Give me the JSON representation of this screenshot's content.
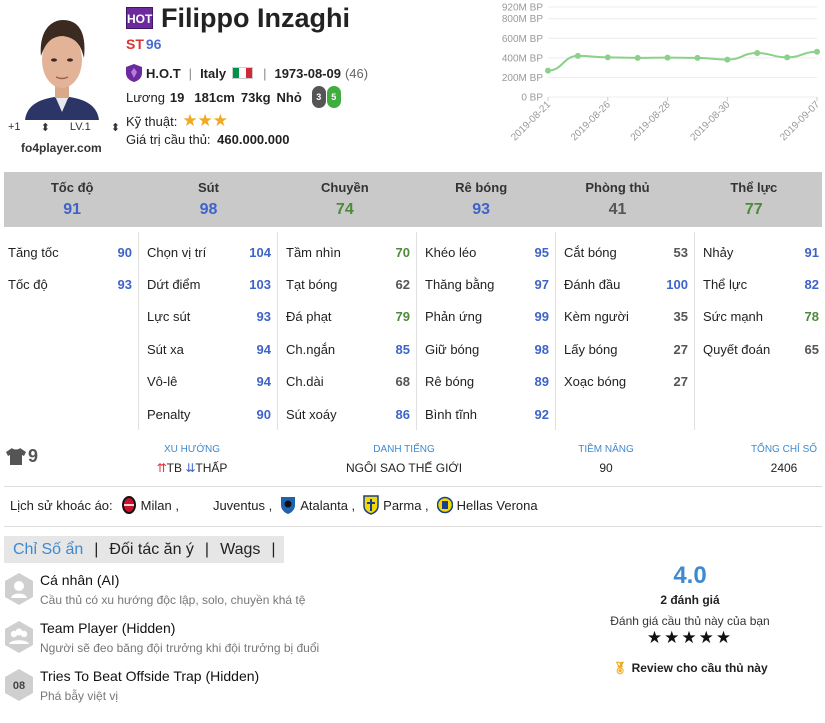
{
  "header": {
    "badge": "HOT",
    "name": "Filippo Inzaghi",
    "position": "ST",
    "overall": "96",
    "season": "H.O.T",
    "nation": "Italy",
    "birthdate": "1973-08-09",
    "age": "(46)",
    "salary_label": "Lương",
    "salary": "19",
    "height": "181cm",
    "weight": "73kg",
    "body": "Nhỏ",
    "weak_foot": "3",
    "strong_foot": "5",
    "skill_label": "Kỹ thuật:",
    "skill_stars": 3,
    "skill_stars_text": "★★★",
    "value_label": "Giá trị cầu thủ:",
    "value": "460.000.000",
    "upgrade": "+1",
    "level": "LV.1",
    "site": "fo4player.com",
    "colors": {
      "hot": "#6c2a9e",
      "position": "#dd3333",
      "overall": "#4c6ccf"
    }
  },
  "price_chart": {
    "type": "line",
    "y_ticks": [
      "920M BP",
      "800M BP",
      "600M BP",
      "400M BP",
      "200M BP",
      "0 BP"
    ],
    "y_tick_values": [
      920,
      800,
      600,
      400,
      200,
      0
    ],
    "x_ticks": [
      "2019-08-21",
      "2019-08-26",
      "2019-08-28",
      "2019-08-30",
      "2019-09-07"
    ],
    "x_tick_index": [
      0,
      2,
      4,
      6,
      9
    ],
    "values": [
      270,
      420,
      405,
      400,
      402,
      400,
      382,
      450,
      405,
      462
    ],
    "ylim": [
      0,
      920
    ],
    "color": "#8bd08b"
  },
  "stats": {
    "headers": [
      {
        "label": "Tốc độ",
        "value": "91",
        "color": "blue"
      },
      {
        "label": "Sút",
        "value": "98",
        "color": "blue"
      },
      {
        "label": "Chuyền",
        "value": "74",
        "color": "green"
      },
      {
        "label": "Rê bóng",
        "value": "93",
        "color": "blue"
      },
      {
        "label": "Phòng thủ",
        "value": "41",
        "color": "grey"
      },
      {
        "label": "Thể lực",
        "value": "77",
        "color": "green"
      }
    ],
    "columns": [
      [
        {
          "label": "Tăng tốc",
          "value": "90",
          "color": "blue"
        },
        {
          "label": "Tốc độ",
          "value": "93",
          "color": "blue"
        }
      ],
      [
        {
          "label": "Chọn vị trí",
          "value": "104",
          "color": "blue"
        },
        {
          "label": "Dứt điểm",
          "value": "103",
          "color": "blue"
        },
        {
          "label": "Lực sút",
          "value": "93",
          "color": "blue"
        },
        {
          "label": "Sút xa",
          "value": "94",
          "color": "blue"
        },
        {
          "label": "Vô-lê",
          "value": "94",
          "color": "blue"
        },
        {
          "label": "Penalty",
          "value": "90",
          "color": "blue"
        }
      ],
      [
        {
          "label": "Tầm nhìn",
          "value": "70",
          "color": "green"
        },
        {
          "label": "Tạt bóng",
          "value": "62",
          "color": "grey"
        },
        {
          "label": "Đá phạt",
          "value": "79",
          "color": "green"
        },
        {
          "label": "Ch.ngắn",
          "value": "85",
          "color": "blue"
        },
        {
          "label": "Ch.dài",
          "value": "68",
          "color": "grey"
        },
        {
          "label": "Sút xoáy",
          "value": "86",
          "color": "blue"
        }
      ],
      [
        {
          "label": "Khéo léo",
          "value": "95",
          "color": "blue"
        },
        {
          "label": "Thăng bằng",
          "value": "97",
          "color": "blue"
        },
        {
          "label": "Phản ứng",
          "value": "99",
          "color": "blue"
        },
        {
          "label": "Giữ bóng",
          "value": "98",
          "color": "blue"
        },
        {
          "label": "Rê bóng",
          "value": "89",
          "color": "blue"
        },
        {
          "label": "Bình tĩnh",
          "value": "92",
          "color": "blue"
        }
      ],
      [
        {
          "label": "Cắt bóng",
          "value": "53",
          "color": "grey"
        },
        {
          "label": "Đánh đầu",
          "value": "100",
          "color": "blue"
        },
        {
          "label": "Kèm người",
          "value": "35",
          "color": "grey"
        },
        {
          "label": "Lấy bóng",
          "value": "27",
          "color": "grey"
        },
        {
          "label": "Xoạc bóng",
          "value": "27",
          "color": "grey"
        }
      ],
      [
        {
          "label": "Nhảy",
          "value": "91",
          "color": "blue"
        },
        {
          "label": "Thể lực",
          "value": "82",
          "color": "blue"
        },
        {
          "label": "Sức mạnh",
          "value": "78",
          "color": "green"
        },
        {
          "label": "Quyết đoán",
          "value": "65",
          "color": "grey"
        }
      ]
    ]
  },
  "info": {
    "shirt_number": "9",
    "trend_label": "XU HƯỚNG",
    "trend_up": "TB",
    "trend_down": "THẤP",
    "reputation_label": "DANH TIẾNG",
    "reputation": "NGÔI SAO THẾ GIỚI",
    "potential_label": "TIỀM NĂNG",
    "potential": "90",
    "total_label": "TỔNG CHỈ SỐ",
    "total": "2406"
  },
  "clubs": {
    "label": "Lịch sử khoác áo:",
    "items": [
      {
        "name": "Milan ,",
        "icon": "milan-crest-icon"
      },
      {
        "name": "Juventus ,",
        "icon": ""
      },
      {
        "name": "Atalanta ,",
        "icon": "atalanta-crest-icon"
      },
      {
        "name": "Parma ,",
        "icon": "parma-crest-icon"
      },
      {
        "name": "Hellas Verona",
        "icon": "verona-crest-icon"
      }
    ]
  },
  "tabs": {
    "items": [
      "Chỉ Số ẩn",
      "Đối tác ăn ý",
      "Wags"
    ],
    "sep": "|"
  },
  "traits": [
    {
      "title": "Cá nhân (AI)",
      "desc": "Cầu thủ có xu hướng độc lập, solo, chuyền khá tệ",
      "icon": "person-trait-icon"
    },
    {
      "title": "Team Player (Hidden)",
      "desc": "Người sẽ đeo băng đội trưởng khi đội trưởng bị đuổi",
      "icon": "team-trait-icon"
    },
    {
      "title": "Tries To Beat Offside Trap (Hidden)",
      "desc": "Phá bẫy việt vị",
      "icon": "offside-trait-icon",
      "icon_text": "08"
    }
  ],
  "rating": {
    "score": "4.0",
    "count": "2 đánh giá",
    "prompt": "Đánh giá cầu thủ này của bạn",
    "stars": "★★★★★",
    "review": "Review cho cầu thủ này"
  }
}
